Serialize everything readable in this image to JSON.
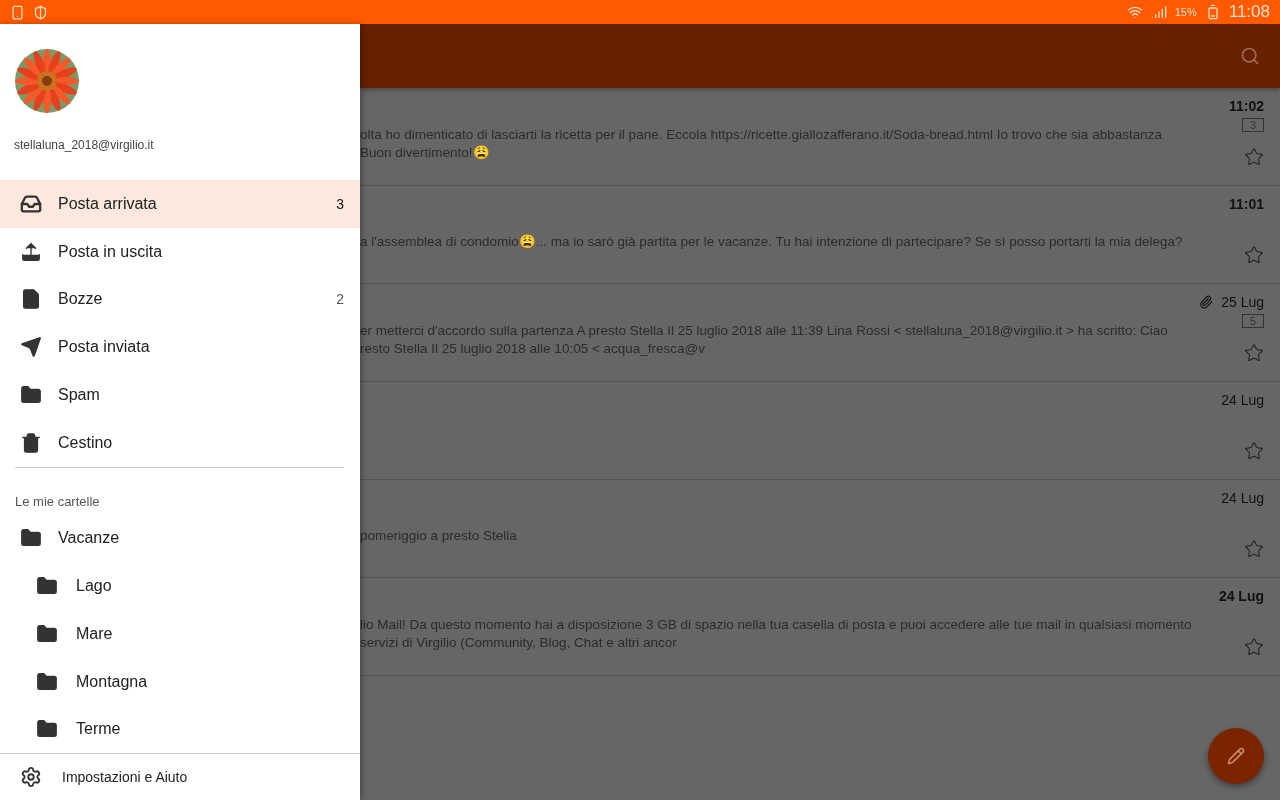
{
  "status_bar": {
    "battery_text": "15%",
    "time": "11:08"
  },
  "drawer": {
    "account": {
      "email": "stellaluna_2018@virgilio.it"
    },
    "items": [
      {
        "label": "Posta arrivata",
        "count": "3",
        "selected": true
      },
      {
        "label": "Posta in uscita",
        "selected": false
      },
      {
        "label": "Bozze",
        "count": "2",
        "selected": false
      },
      {
        "label": "Posta inviata",
        "selected": false
      },
      {
        "label": "Spam",
        "selected": false
      },
      {
        "label": "Cestino",
        "selected": false
      }
    ],
    "section_title": "Le mie cartelle",
    "folders": [
      {
        "label": "Vacanze",
        "selected": false,
        "children": [
          {
            "label": "Lago",
            "selected": false
          },
          {
            "label": "Mare",
            "selected": false
          },
          {
            "label": "Montagna",
            "selected": false
          },
          {
            "label": "Terme",
            "selected": false
          }
        ]
      }
    ],
    "footer": {
      "label": "Impostazioni e Aiuto"
    }
  },
  "messages": [
    {
      "date": "11:02",
      "unread": true,
      "count": "3",
      "attachment": false,
      "starred": false,
      "preview": [
        "olta ho dimenticato di lasciarti la ricetta per il pane. Eccola https://ricette.giallozafferano.it/Soda-bread.html Io trovo che sia abbastanza",
        "Buon divertimento!😩"
      ]
    },
    {
      "date": "11:01",
      "unread": true,
      "attachment": false,
      "starred": false,
      "preview": [
        "a l'assemblea di condomio😩... ma io sarò già partita per le vacanze. Tu hai intenzione di partecipare? Se sì posso portarti la mia delega?"
      ]
    },
    {
      "date": "25 Lug",
      "unread": false,
      "count": "5",
      "attachment": true,
      "starred": false,
      "preview": [
        "er metterci d'accordo sulla partenza A presto Stella Il 25 luglio 2018 alle 11:39 Lina Rossi < stellaluna_2018@virgilio.it > ha scritto: Ciao",
        "resto Stella Il 25 luglio 2018 alle 10:05 < acqua_fresca@v"
      ]
    },
    {
      "date": "24 Lug",
      "unread": false,
      "attachment": false,
      "starred": false
    },
    {
      "date": "24 Lug",
      "unread": false,
      "attachment": false,
      "starred": false,
      "preview": [
        "pomeriggio a presto Stella"
      ]
    },
    {
      "date": "24 Lug",
      "unread": true,
      "attachment": false,
      "starred": false,
      "preview": [
        "lio Mail! Da questo momento hai a disposizione 3 GB di spazio nella tua casella di posta e puoi accedere alle tue mail in qualsiasi momento",
        "servizi di Virgilio (Community, Blog, Chat e altri ancor"
      ]
    }
  ]
}
